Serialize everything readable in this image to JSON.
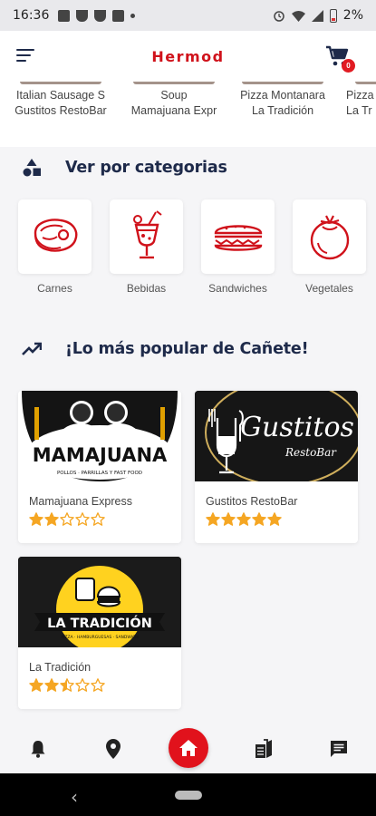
{
  "status_bar": {
    "time": "16:36",
    "battery_percent": "2%"
  },
  "header": {
    "title": "Hermod",
    "cart_count": "0"
  },
  "featured": [
    {
      "line1": "Italian Sausage S",
      "line2": "Gustitos RestoBar"
    },
    {
      "line1": "Soup",
      "line2": "Mamajuana Expr"
    },
    {
      "line1": "Pizza Montanara",
      "line2": "La Tradición"
    },
    {
      "line1": "Pizza",
      "line2": "La Tr"
    }
  ],
  "categories_section": {
    "title": "Ver por categorias"
  },
  "categories": [
    {
      "label": "Carnes",
      "icon": "meat-icon"
    },
    {
      "label": "Bebidas",
      "icon": "cocktail-icon"
    },
    {
      "label": "Sandwiches",
      "icon": "sandwich-icon"
    },
    {
      "label": "Vegetales",
      "icon": "tomato-icon"
    }
  ],
  "popular_section": {
    "title": "¡Lo más popular de Cañete!"
  },
  "restaurants": [
    {
      "name": "Mamajuana Express",
      "rating": 2,
      "logo_text": "MAMAJUANA",
      "logo_sub": "POLLOS · PARRILLAS Y FAST FOOD"
    },
    {
      "name": "Gustitos RestoBar",
      "rating": 5,
      "logo_text": "Gustitos",
      "logo_sub": "RestoBar"
    },
    {
      "name": "La Tradición",
      "rating": 2.5,
      "logo_text": "LA TRADICIÓN",
      "logo_sub": "PIZZA · HAMBURGUESAS · SANDWICH"
    }
  ],
  "colors": {
    "brand_red": "#d0121b",
    "navy": "#1e2a4a",
    "star": "#f5a623"
  },
  "bottom_nav": [
    "bell-icon",
    "location-pin-icon",
    "home-icon",
    "menu-book-icon",
    "chat-icon"
  ]
}
